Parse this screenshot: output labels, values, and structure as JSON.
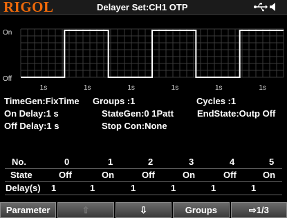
{
  "header": {
    "logo": "RIGOL",
    "title": "Delayer Set:CH1 OTP"
  },
  "waveform": {
    "level_high": "On",
    "level_low": "Off",
    "segment_labels": [
      "1s",
      "1s",
      "1s",
      "1s",
      "1s",
      "1s"
    ],
    "states": [
      "Off",
      "On",
      "Off",
      "On",
      "Off",
      "On"
    ]
  },
  "info": {
    "timegen": "TimeGen:FixTime",
    "groups": "Groups  :1",
    "cycles": "Cycles   :1",
    "on_delay": "On Delay:1 s",
    "stategen": "StateGen:0 1Patt",
    "endstate": "EndState:Outp Off",
    "off_delay": "Off Delay:1 s",
    "stop_con": "Stop Con:None"
  },
  "table": {
    "head": [
      "No.",
      "0",
      "1",
      "2",
      "3",
      "4",
      "5"
    ],
    "state_label": "State",
    "states": [
      "Off",
      "On",
      "Off",
      "On",
      "Off",
      "On"
    ],
    "delay_label": "Delay(s)",
    "delays": [
      "1",
      "1",
      "1",
      "1",
      "1",
      "1"
    ]
  },
  "toolbar": {
    "parameter": "Parameter",
    "up": "⇧",
    "down": "⇩",
    "groups": "Groups",
    "page": "⇨1/3"
  },
  "colors": {
    "logo": "#f06a0a",
    "wave": "#ffffff",
    "grid": "#3a3a3a"
  }
}
